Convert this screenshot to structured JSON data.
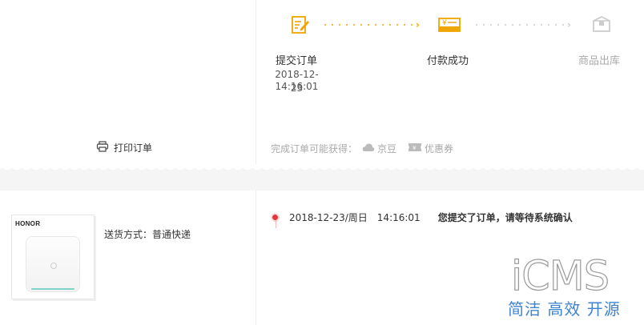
{
  "print": {
    "label": "打印订单",
    "icon": "printer-icon"
  },
  "steps": [
    {
      "label": "提交订单",
      "icon": "edit-form-icon",
      "state": "done"
    },
    {
      "label": "付款成功",
      "icon": "payment-card-icon",
      "state": "done"
    },
    {
      "label": "商品出库",
      "icon": "package-icon",
      "state": "pending"
    }
  ],
  "submit_time": {
    "date": "2018-12-23",
    "time": "14:16:01"
  },
  "bonus": {
    "prefix": "完成订单可能获得：",
    "items": [
      {
        "label": "京豆",
        "icon": "jingdou-cloud-icon"
      },
      {
        "label": "优惠券",
        "icon": "coupon-icon"
      }
    ]
  },
  "product": {
    "brand": "HONOR",
    "image": "router-image"
  },
  "shipping": {
    "text": "送货方式：普通快递"
  },
  "tracking": [
    {
      "date": "2018-12-23/周日",
      "time": "14:16:01",
      "message": "您提交了订单，请等待系统确认"
    }
  ],
  "watermark": {
    "title": "iCMS",
    "subtitle": "简洁 高效 开源"
  },
  "colors": {
    "accent": "#f0a500",
    "inactive": "#cccccc",
    "status_red": "#e4393c",
    "watermark_blue": "#3e83cf"
  }
}
